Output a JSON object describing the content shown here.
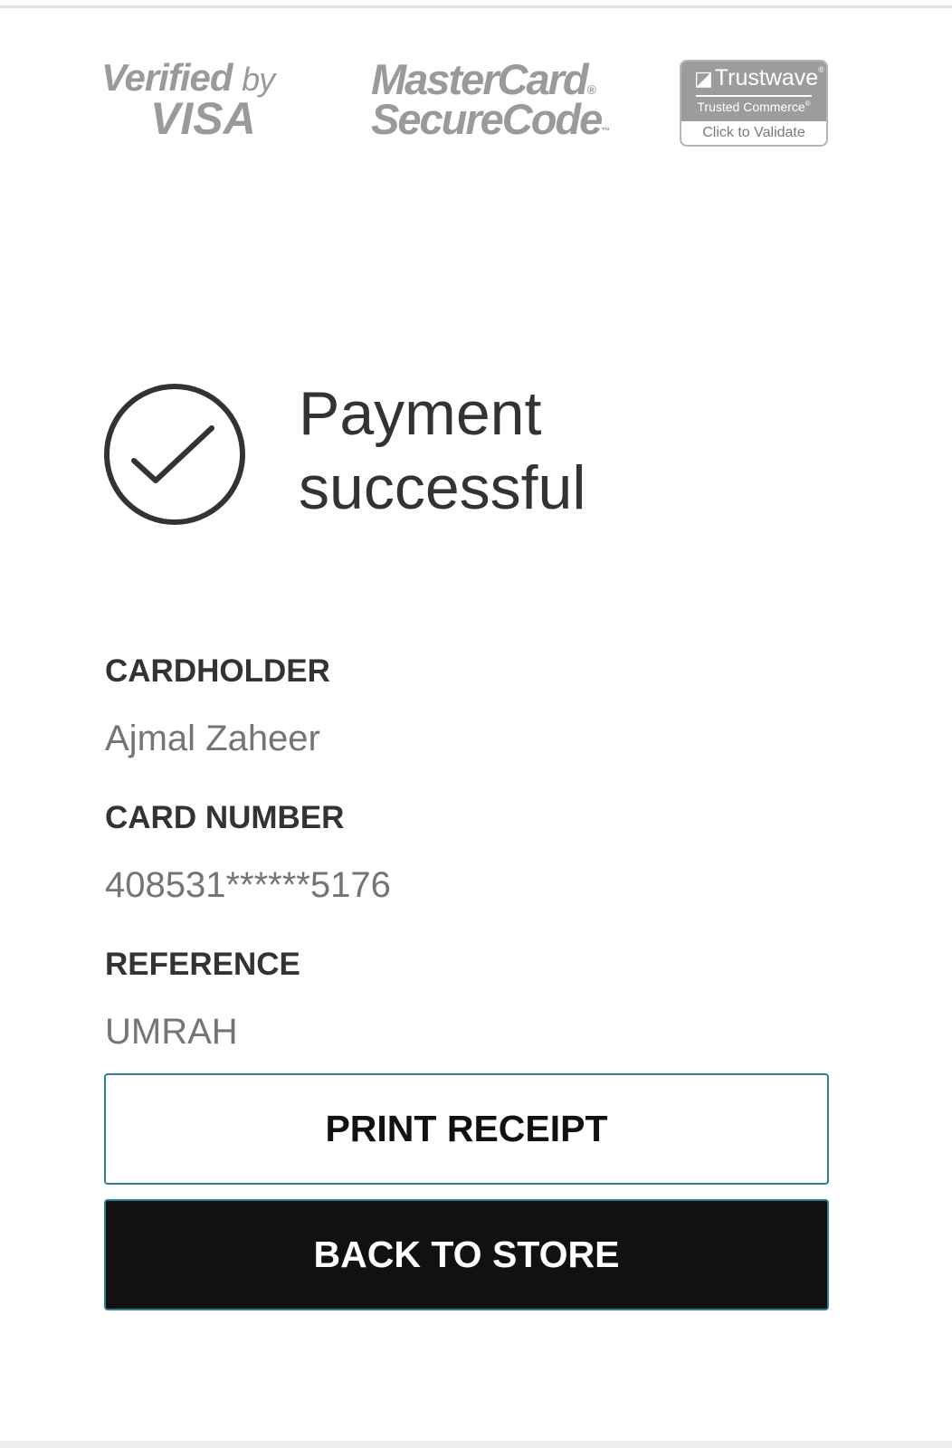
{
  "badges": {
    "visa": {
      "line1": "Verified",
      "line1_by": "by",
      "line2": "VISA"
    },
    "mastercard": {
      "line1": "MasterCard",
      "line1_mark": "®",
      "line2": "SecureCode",
      "line2_mark": "™"
    },
    "trustwave": {
      "name": "Trustwave",
      "name_mark": "®",
      "subtitle": "Trusted Commerce",
      "subtitle_mark": "®",
      "action": "Click to Validate"
    }
  },
  "status": {
    "title_line1": "Payment",
    "title_line2": "successful",
    "icon": "check-circle-icon"
  },
  "details": {
    "cardholder_label": "CARDHOLDER",
    "cardholder_value": "Ajmal Zaheer",
    "card_number_label": "CARD NUMBER",
    "card_number_value": "408531******5176",
    "reference_label": "REFERENCE",
    "reference_value": "UMRAH"
  },
  "actions": {
    "print_label": "PRINT RECEIPT",
    "back_label": "BACK TO STORE"
  },
  "colors": {
    "text_dark": "#333333",
    "text_muted": "#757575",
    "badge_gray": "#9a9a9a",
    "button_border": "#2f7f95",
    "button_dark": "#111111"
  }
}
